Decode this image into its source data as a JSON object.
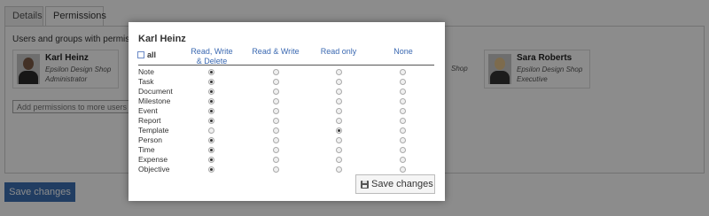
{
  "tabs": [
    {
      "label": "Details"
    },
    {
      "label": "Permissions"
    }
  ],
  "panel": {
    "label": "Users and groups with permissions",
    "users": [
      {
        "name": "Karl Heinz",
        "company": "Epsilon Design Shop",
        "role": "Administrator"
      },
      {
        "name": "Sara Roberts",
        "company": "Epsilon Design Shop",
        "role": "Executive"
      }
    ],
    "partial_company_fragment": "Shop",
    "add_permissions_placeholder": "Add permissions to more users or"
  },
  "background_save_label": "Save changes",
  "modal": {
    "title": "Karl Heinz",
    "all_label": "all",
    "columns": [
      "Read, Write & Delete",
      "Read & Write",
      "Read only",
      "None"
    ],
    "rows": [
      {
        "label": "Note",
        "selected": 0
      },
      {
        "label": "Task",
        "selected": 0
      },
      {
        "label": "Document",
        "selected": 0
      },
      {
        "label": "Milestone",
        "selected": 0
      },
      {
        "label": "Event",
        "selected": 0
      },
      {
        "label": "Report",
        "selected": 0
      },
      {
        "label": "Template",
        "selected": 2
      },
      {
        "label": "Person",
        "selected": 0
      },
      {
        "label": "Time",
        "selected": 0
      },
      {
        "label": "Expense",
        "selected": 0
      },
      {
        "label": "Objective",
        "selected": 0
      }
    ],
    "save_label": "Save changes"
  },
  "colors": {
    "accent": "#3c6fb3",
    "column_header": "#3a68b1",
    "overlay": "rgba(0,0,0,0.45)"
  },
  "icons": {
    "save": "floppy-disk-icon"
  }
}
